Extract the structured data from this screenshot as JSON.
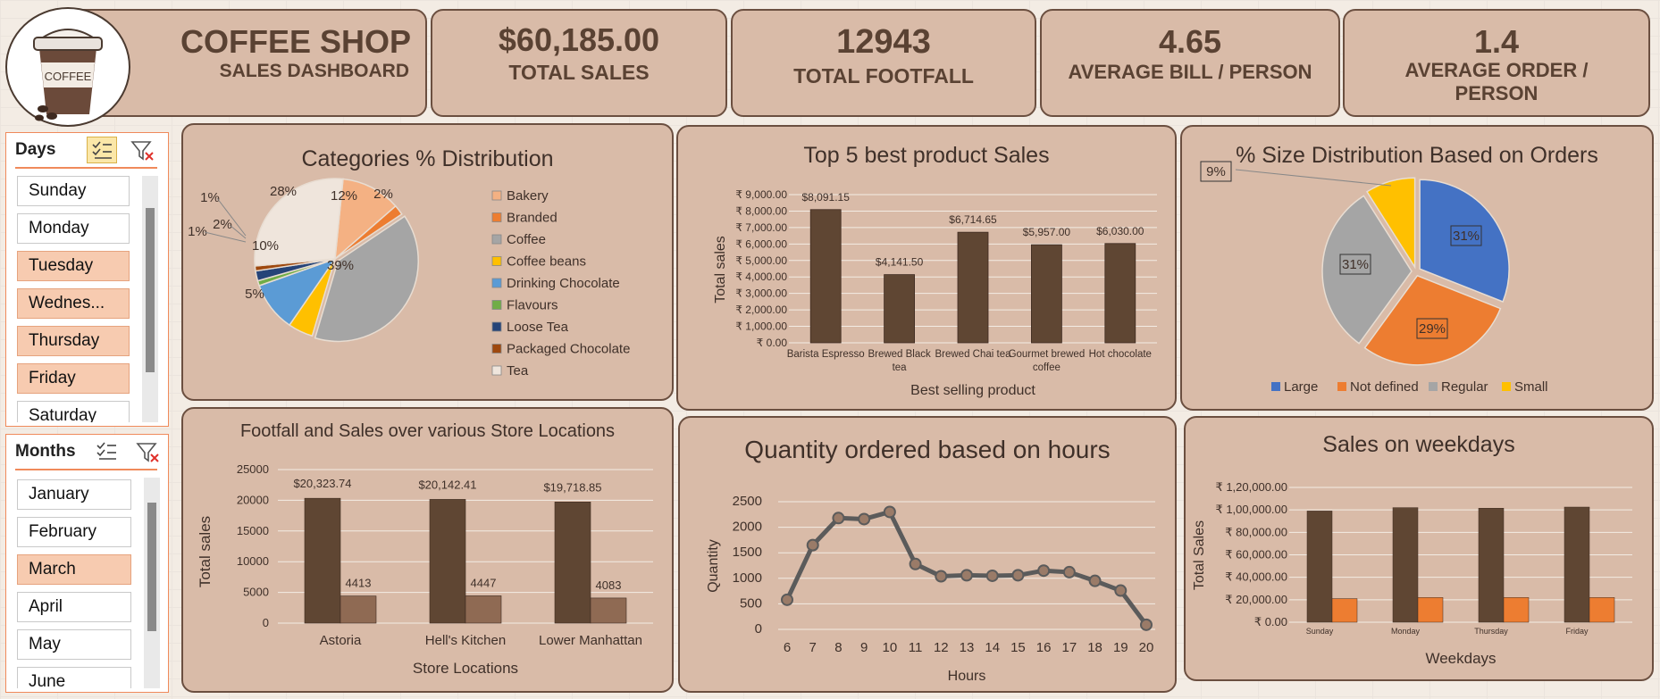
{
  "header": {
    "title": "COFFEE SHOP",
    "subtitle": "SALES DASHBOARD",
    "logo_text": "COFFEE"
  },
  "kpis": [
    {
      "value": "$60,185.00",
      "label": "TOTAL SALES"
    },
    {
      "value": "12943",
      "label": "TOTAL FOOTFALL"
    },
    {
      "value": "4.65",
      "label": "AVERAGE BILL / PERSON"
    },
    {
      "value": "1.4",
      "label": "AVERAGE ORDER / PERSON"
    }
  ],
  "slicers": {
    "days": {
      "title": "Days",
      "items": [
        {
          "label": "Sunday",
          "selected": false
        },
        {
          "label": "Monday",
          "selected": false
        },
        {
          "label": "Tuesday",
          "selected": true
        },
        {
          "label": "Wednes...",
          "selected": true
        },
        {
          "label": "Thursday",
          "selected": true
        },
        {
          "label": "Friday",
          "selected": true
        },
        {
          "label": "Saturday",
          "selected": false
        }
      ]
    },
    "months": {
      "title": "Months",
      "items": [
        {
          "label": "January",
          "selected": false
        },
        {
          "label": "February",
          "selected": false
        },
        {
          "label": "March",
          "selected": true
        },
        {
          "label": "April",
          "selected": false
        },
        {
          "label": "May",
          "selected": false
        },
        {
          "label": "June",
          "selected": false
        }
      ]
    }
  },
  "chart_data": [
    {
      "type": "pie",
      "title": "Categories % Distribution",
      "labels": [
        "Bakery",
        "Branded",
        "Coffee",
        "Coffee beans",
        "Drinking Chocolate",
        "Flavours",
        "Loose Tea",
        "Packaged Chocolate",
        "Tea"
      ],
      "values": [
        12,
        2,
        39,
        5,
        10,
        1,
        2,
        1,
        28
      ],
      "data_labels": [
        "12%",
        "2%",
        "39%",
        "5%",
        "10%",
        "1%",
        "2%",
        "1%",
        "28%"
      ],
      "colors": [
        "#f4b183",
        "#ed7d31",
        "#a5a5a5",
        "#ffc000",
        "#5b9bd5",
        "#70ad47",
        "#264478",
        "#9e480e",
        "#efe5dc"
      ],
      "legend": "right"
    },
    {
      "type": "bar",
      "title": "Top 5 best product Sales",
      "categories": [
        "Barista Espresso",
        "Brewed Black tea",
        "Brewed Chai tea",
        "Gourmet brewed coffee",
        "Hot chocolate"
      ],
      "values": [
        8091.15,
        4141.5,
        6714.65,
        5957.0,
        6030.0
      ],
      "data_labels": [
        "$8,091.15",
        "$4,141.50",
        "$6,714.65",
        "$5,957.00",
        "$6,030.00"
      ],
      "xlabel": "Best selling product",
      "ylabel": "Total sales",
      "ylim": [
        0,
        9000
      ],
      "yticks": [
        "₹ 0.00",
        "₹ 1,000.00",
        "₹ 2,000.00",
        "₹ 3,000.00",
        "₹ 4,000.00",
        "₹ 5,000.00",
        "₹ 6,000.00",
        "₹ 7,000.00",
        "₹ 8,000.00",
        "₹ 9,000.00"
      ],
      "color": "#5f4633"
    },
    {
      "type": "pie",
      "title": "% Size Distribution Based on Orders",
      "labels": [
        "Large",
        "Not defined",
        "Regular",
        "Small"
      ],
      "values": [
        31,
        29,
        31,
        9
      ],
      "data_labels": [
        "31%",
        "29%",
        "31%",
        "9%"
      ],
      "colors": [
        "#4472c4",
        "#ed7d31",
        "#a5a5a5",
        "#ffc000"
      ],
      "legend": "bottom"
    },
    {
      "type": "bar",
      "title": "Footfall and Sales over various Store Locations",
      "categories": [
        "Astoria",
        "Hell's Kitchen",
        "Lower Manhattan"
      ],
      "series": [
        {
          "values": [
            20323.74,
            20142.41,
            19718.85
          ],
          "data_labels": [
            "$20,323.74",
            "$20,142.41",
            "$19,718.85"
          ],
          "color": "#5f4633"
        },
        {
          "values": [
            4413,
            4447,
            4083
          ],
          "data_labels": [
            "4413",
            "4447",
            "4083"
          ],
          "color": "#8f6a53"
        }
      ],
      "xlabel": "Store Locations",
      "ylabel": "Total sales",
      "ylim": [
        0,
        25000
      ],
      "yticks": [
        "0",
        "5000",
        "10000",
        "15000",
        "20000",
        "25000"
      ]
    },
    {
      "type": "line",
      "title": "Quantity ordered based on hours",
      "x": [
        6,
        7,
        8,
        9,
        10,
        11,
        12,
        13,
        14,
        15,
        16,
        17,
        18,
        19,
        20
      ],
      "values": [
        580,
        1650,
        2180,
        2160,
        2300,
        1280,
        1040,
        1060,
        1050,
        1060,
        1150,
        1120,
        950,
        760,
        90
      ],
      "xlabel": "Hours",
      "ylabel": "Quantity",
      "ylim": [
        0,
        2500
      ],
      "yticks": [
        "0",
        "500",
        "1000",
        "1500",
        "2000",
        "2500"
      ],
      "color": "#5b5b5b"
    },
    {
      "type": "bar",
      "title": "Sales on weekdays",
      "categories": [
        "Sunday",
        "Monday",
        "Thursday",
        "Friday"
      ],
      "series": [
        {
          "values": [
            99000,
            102000,
            101500,
            102500
          ],
          "color": "#5f4633"
        },
        {
          "values": [
            21000,
            22000,
            22000,
            22000
          ],
          "color": "#ed7d31"
        }
      ],
      "xlabel": "Weekdays",
      "ylabel": "Total Sales",
      "ylim": [
        0,
        120000
      ],
      "yticks": [
        "₹ 0.00",
        "₹ 20,000.00",
        "₹ 40,000.00",
        "₹ 60,000.00",
        "₹ 80,000.00",
        "₹ 1,00,000.00",
        "₹ 1,20,000.00"
      ]
    }
  ]
}
